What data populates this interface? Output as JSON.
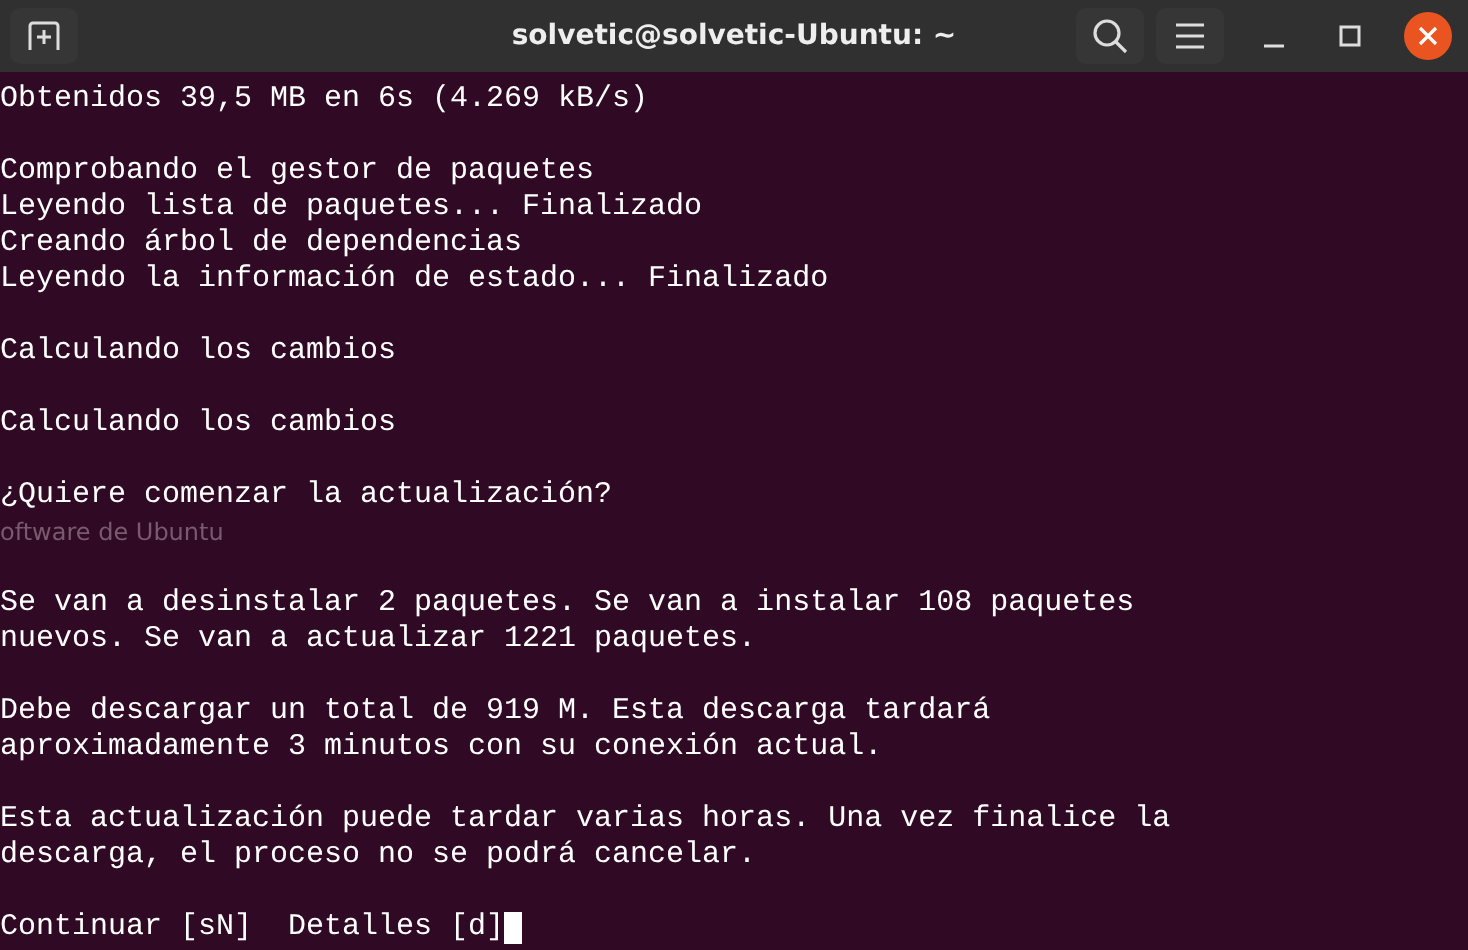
{
  "window": {
    "title": "solvetic@solvetic-Ubuntu: ~"
  },
  "lines": [
    {
      "kind": "text",
      "text": "Obtenidos 39,5 MB en 6s (4.269 kB/s)"
    },
    {
      "kind": "blank"
    },
    {
      "kind": "text",
      "text": "Comprobando el gestor de paquetes"
    },
    {
      "kind": "text",
      "text": "Leyendo lista de paquetes... Finalizado"
    },
    {
      "kind": "text",
      "text": "Creando árbol de dependencias"
    },
    {
      "kind": "text",
      "text": "Leyendo la información de estado... Finalizado"
    },
    {
      "kind": "blank"
    },
    {
      "kind": "text",
      "text": "Calculando los cambios"
    },
    {
      "kind": "blank"
    },
    {
      "kind": "text",
      "text": "Calculando los cambios"
    },
    {
      "kind": "blank"
    },
    {
      "kind": "text",
      "text": "¿Quiere comenzar la actualización?"
    },
    {
      "kind": "faint",
      "text": "oftware de Ubuntu"
    },
    {
      "kind": "blank"
    },
    {
      "kind": "text",
      "text": "Se van a desinstalar 2 paquetes. Se van a instalar 108 paquetes"
    },
    {
      "kind": "text",
      "text": "nuevos. Se van a actualizar 1221 paquetes."
    },
    {
      "kind": "blank"
    },
    {
      "kind": "text",
      "text": "Debe descargar un total de 919 M. Esta descarga tardará"
    },
    {
      "kind": "text",
      "text": "aproximadamente 3 minutos con su conexión actual."
    },
    {
      "kind": "blank"
    },
    {
      "kind": "text",
      "text": "Esta actualización puede tardar varias horas. Una vez finalice la"
    },
    {
      "kind": "text",
      "text": "descarga, el proceso no se podrá cancelar."
    },
    {
      "kind": "blank"
    },
    {
      "kind": "prompt",
      "text": "Continuar [sN]  Detalles [d]"
    }
  ]
}
